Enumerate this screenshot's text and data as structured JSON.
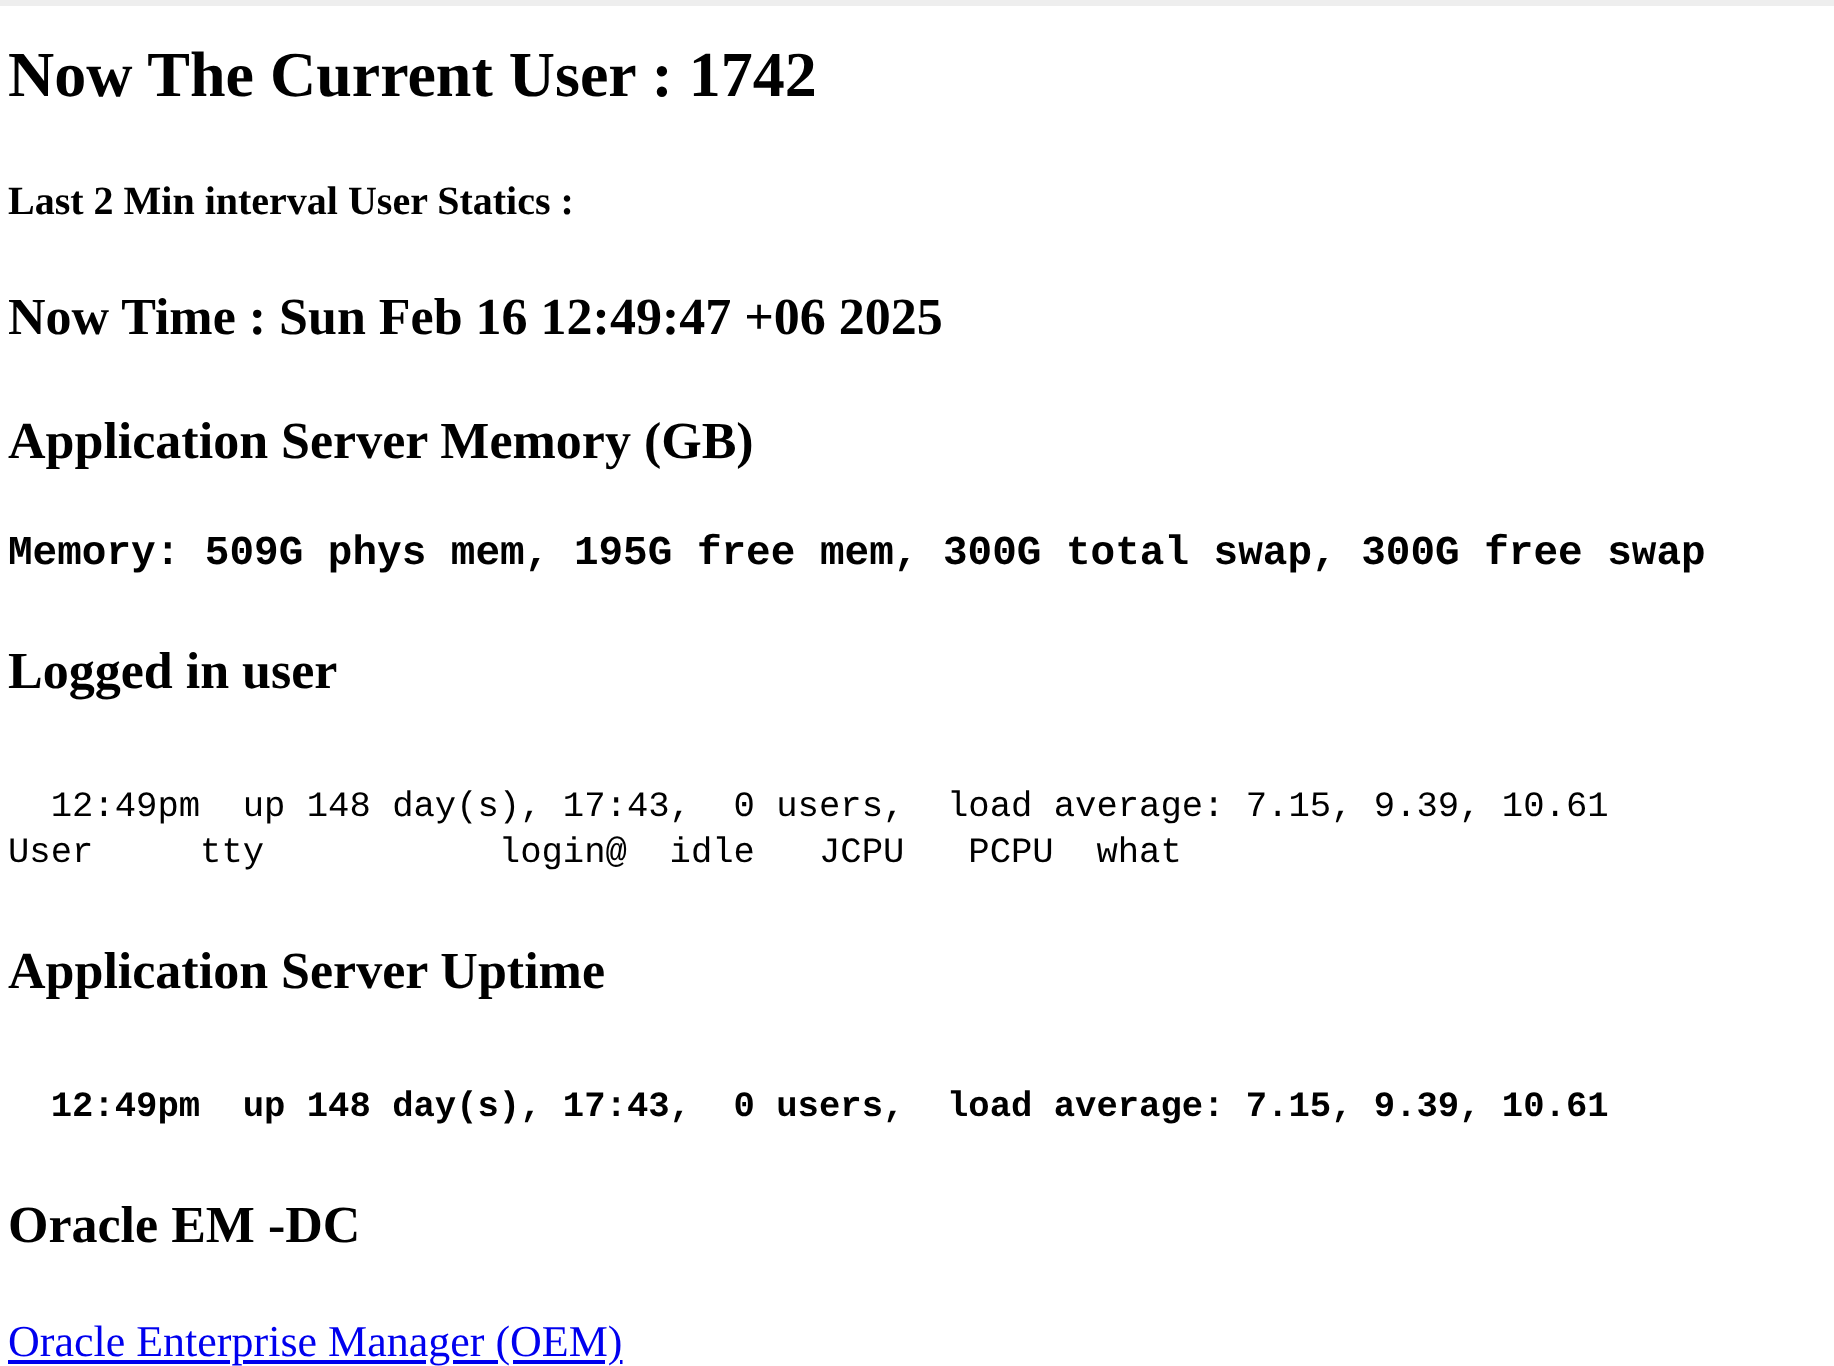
{
  "current_user": {
    "label": "Now The Current User : 1742"
  },
  "interval_stats": {
    "label": "Last 2 Min interval User Statics :"
  },
  "now_time": {
    "label": "Now Time : Sun Feb 16 12:49:47 +06 2025"
  },
  "sections": [
    {
      "kind": "memory",
      "heading": "Application Server Memory (GB)",
      "lines": [
        "Memory: 509G phys mem, 195G free mem, 300G total swap, 300G free swap"
      ]
    },
    {
      "kind": "plain",
      "heading": "Logged in user",
      "lines": [
        "  12:49pm  up 148 day(s), 17:43,  0 users,  load average: 7.15, 9.39, 10.61",
        "User     tty           login@  idle   JCPU   PCPU  what"
      ]
    },
    {
      "kind": "bold",
      "heading": "Application Server Uptime",
      "lines": [
        "  12:49pm  up 148 day(s), 17:43,  0 users,  load average: 7.15, 9.39, 10.61"
      ]
    },
    {
      "kind": "link",
      "heading": "Oracle EM -DC",
      "link": "Oracle Enterprise Manager (OEM)"
    }
  ]
}
